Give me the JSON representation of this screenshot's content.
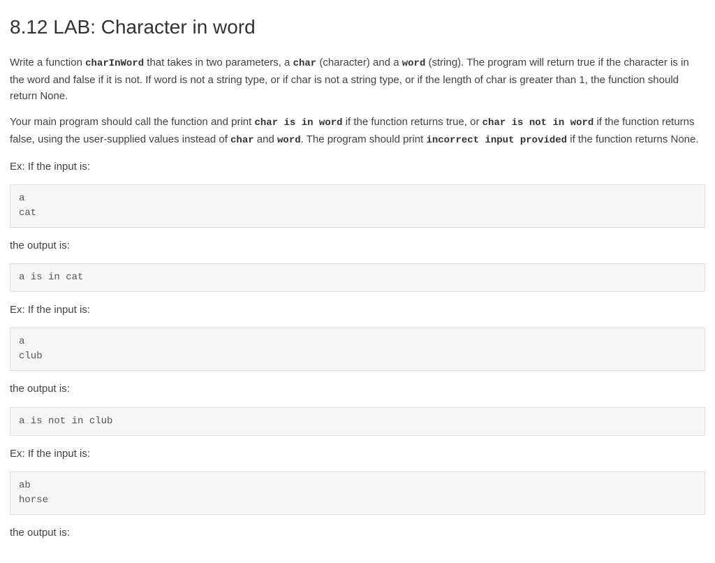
{
  "title": "8.12 LAB: Character in word",
  "para1": {
    "t1": "Write a function ",
    "c1": "charInWord",
    "t2": " that takes in two parameters, a ",
    "c2": "char",
    "t3": " (character) and a ",
    "c3": "word",
    "t4": " (string). The program will return true if the character is in the word and false if it is not. If word is not a string type, or if char is not a string type, or if the length of char is greater than 1, the function should return None."
  },
  "para2": {
    "t1": "Your main program should call the function and print ",
    "c1": "char is in word",
    "t2": " if the function returns true, or ",
    "c2": "char is not in word",
    "t3": " if the function returns false, using the user-supplied values instead of ",
    "c3": "char",
    "t4": " and ",
    "c4": "word",
    "t5": ". The program should print ",
    "c5": "incorrect input provided",
    "t6": " if the function returns None."
  },
  "ex_input_label": "Ex: If the input is:",
  "output_label": "the output is:",
  "block1": "a\ncat",
  "block2": "a is in cat",
  "block3": "a\nclub",
  "block4": "a is not in club",
  "block5": "ab\nhorse"
}
